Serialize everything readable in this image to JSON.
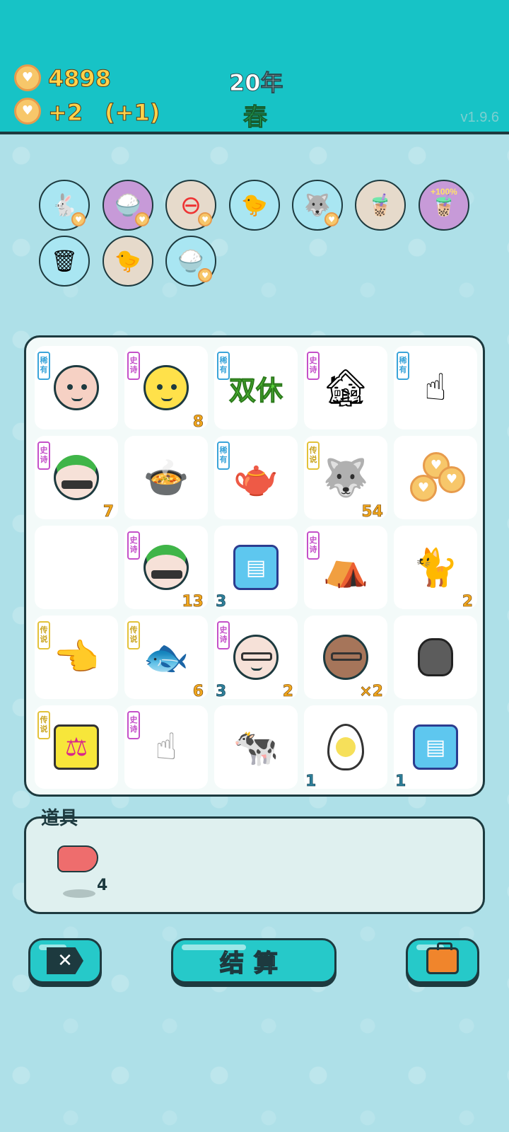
{
  "header": {
    "coins": "4898",
    "income": "+2",
    "income_bonus": "(+1)",
    "year": "20年",
    "season": "春",
    "version": "v1.9.6"
  },
  "buffs": [
    {
      "name": "rabbit-heart-icon",
      "tag": ""
    },
    {
      "name": "rice-bowl-heart-icon",
      "tag": ""
    },
    {
      "name": "minus-heart-icon",
      "tag": ""
    },
    {
      "name": "chicken-egg-icon",
      "tag": ""
    },
    {
      "name": "husky-heart-icon",
      "tag": ""
    },
    {
      "name": "milk-tea-icon",
      "tag": ""
    },
    {
      "name": "milk-tea-boost-icon",
      "tag": "+100%"
    },
    {
      "name": "trash-recycle-icon",
      "tag": ""
    },
    {
      "name": "chicken-egg-icon",
      "tag": ""
    },
    {
      "name": "rice-bowl-heart-icon",
      "tag": ""
    }
  ],
  "tags": {
    "rare": "稀有",
    "epic": "史诗",
    "legend": "传说"
  },
  "board": [
    {
      "icon": "bald-man-icon",
      "tag": "rare",
      "num_r": "",
      "num_l": ""
    },
    {
      "icon": "yellow-chick-face-icon",
      "tag": "epic",
      "num_r": "8",
      "num_l": ""
    },
    {
      "icon": "double-rest-icon",
      "tag": "rare",
      "num_r": "",
      "num_l": "",
      "text": "双休"
    },
    {
      "icon": "haunted-house-icon",
      "tag": "epic",
      "num_r": "",
      "num_l": ""
    },
    {
      "icon": "pointing-hand-brown-icon",
      "tag": "rare",
      "num_r": "",
      "num_l": ""
    },
    {
      "icon": "green-hat-man-question-icon",
      "tag": "epic",
      "num_r": "7",
      "num_l": ""
    },
    {
      "icon": "soup-bowl-icon",
      "tag": "",
      "num_r": "",
      "num_l": ""
    },
    {
      "icon": "teapot-icon",
      "tag": "rare",
      "num_r": "",
      "num_l": ""
    },
    {
      "icon": "husky-king-icon",
      "tag": "legend",
      "num_r": "54",
      "num_l": ""
    },
    {
      "icon": "heart-coins-icon",
      "tag": "",
      "num_r": "",
      "num_l": ""
    },
    {
      "icon": "empty-cell",
      "tag": "",
      "num_r": "",
      "num_l": ""
    },
    {
      "icon": "green-hat-man-icon",
      "tag": "epic",
      "num_r": "13",
      "num_l": ""
    },
    {
      "icon": "silver-bars-icon",
      "tag": "",
      "num_r": "",
      "num_l": "3"
    },
    {
      "icon": "rabbit-lantern-house-icon",
      "tag": "epic",
      "num_r": "",
      "num_l": ""
    },
    {
      "icon": "orange-cat-icon",
      "tag": "",
      "num_r": "2",
      "num_l": ""
    },
    {
      "icon": "pointing-hand-yellow-icon",
      "tag": "legend",
      "num_r": "",
      "num_l": ""
    },
    {
      "icon": "koi-fish-icon",
      "tag": "legend",
      "num_r": "6",
      "num_l": ""
    },
    {
      "icon": "old-man-glasses-icon",
      "tag": "epic",
      "num_r": "2",
      "num_l": "3"
    },
    {
      "icon": "monkey-glasses-icon",
      "tag": "",
      "num_r": "×2",
      "num_l": ""
    },
    {
      "icon": "garbage-bag-icon",
      "tag": "",
      "num_r": "",
      "num_l": ""
    },
    {
      "icon": "scales-icon",
      "tag": "legend",
      "num_r": "",
      "num_l": ""
    },
    {
      "icon": "pointing-hand-gray-icon",
      "tag": "epic",
      "num_r": "",
      "num_l": ""
    },
    {
      "icon": "cow-icon",
      "tag": "",
      "num_r": "",
      "num_l": ""
    },
    {
      "icon": "boiled-egg-icon",
      "tag": "",
      "num_r": "",
      "num_l": "1"
    },
    {
      "icon": "silver-bars-icon",
      "tag": "",
      "num_r": "",
      "num_l": "1"
    }
  ],
  "props": {
    "title": "道具",
    "item_icon": "liver-icon",
    "item_count": "4"
  },
  "buttons": {
    "exit_icon": "exit-x-icon",
    "settle_label": "结算",
    "bag_icon": "briefcase-icon"
  },
  "colors": {
    "header_bg": "#17c3c6",
    "page_bg": "#aee0e8",
    "button_bg": "#26c9c9",
    "coin_gold": "#ffd24a",
    "season_green": "#2bd06b"
  }
}
